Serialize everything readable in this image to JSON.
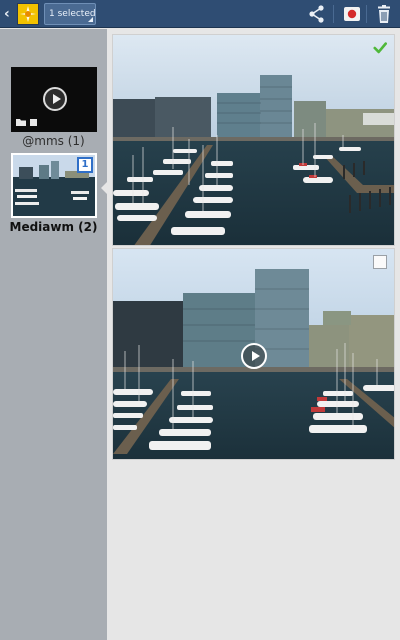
{
  "topbar": {
    "selection_label": "1 selected",
    "icons": [
      "back-icon",
      "gallery-app-icon",
      "share-icon",
      "record-icon",
      "delete-icon"
    ]
  },
  "sidebar": {
    "albums": [
      {
        "label": "@mms (1)",
        "kind": "video-album"
      },
      {
        "label": "Mediawm (2)",
        "badge": "1",
        "selected": true
      }
    ]
  },
  "grid": {
    "items": [
      {
        "kind": "photo",
        "checked": true
      },
      {
        "kind": "video",
        "checked": false
      }
    ]
  },
  "colors": {
    "topbar": "#2f4d73",
    "sidebar": "#a8adb3",
    "content_bg": "#e6e6e6",
    "accent_blue": "#2f6fc8",
    "check_green": "#4fb83a"
  }
}
